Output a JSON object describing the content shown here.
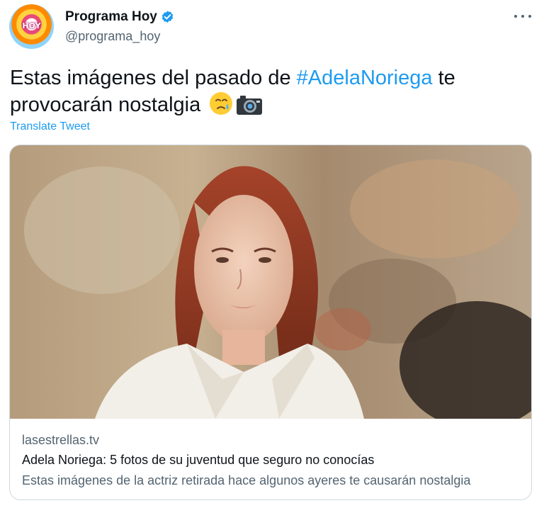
{
  "author": {
    "display_name": "Programa Hoy",
    "handle": "@programa_hoy",
    "avatar_logo_text": "HOY",
    "verified": true
  },
  "tweet": {
    "text_before": "Estas imágenes del pasado de ",
    "hashtag": "#AdelaNoriega",
    "text_after": " te provocarán nostalgia",
    "emojis": [
      "face-holding-back-tears-icon",
      "camera-icon"
    ],
    "translate_label": "Translate Tweet"
  },
  "card": {
    "domain": "lasestrellas.tv",
    "title": "Adela Noriega: 5 fotos de su juventud que seguro no conocías",
    "description": "Estas imágenes de la actriz retirada hace algunos ayeres te causarán nostalgia"
  },
  "colors": {
    "link": "#1d9bf0",
    "secondary_text": "#536471",
    "primary_text": "#0f1419",
    "border": "#cfd9de"
  }
}
